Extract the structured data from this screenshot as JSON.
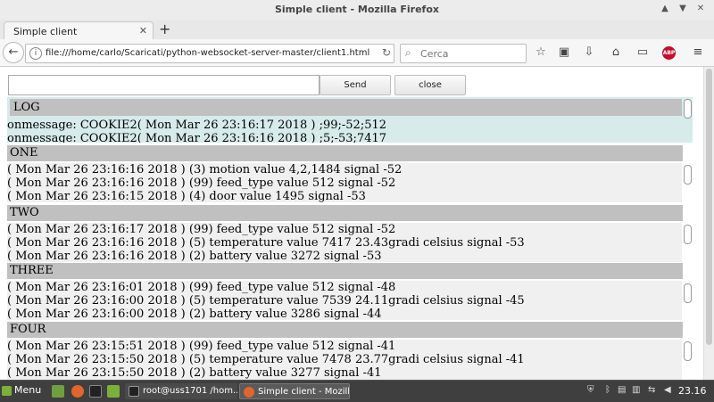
{
  "window": {
    "title": "Simple client - Mozilla Firefox"
  },
  "tab": {
    "label": "Simple client"
  },
  "nav": {
    "url": "file:///home/carlo/Scaricati/python-websocket-server-master/client1.html",
    "search_placeholder": "Cerca"
  },
  "form": {
    "send_label": "Send",
    "close_label": "close"
  },
  "log": {
    "title": "LOG",
    "lines": [
      "onmessage: COOKIE2( Mon Mar 26 23:16:17 2018 ) ;99;-52;512",
      "onmessage: COOKIE2( Mon Mar 26 23:16:16 2018 ) ;5;-53;7417"
    ]
  },
  "sections": [
    {
      "title": "ONE",
      "lines": [
        "( Mon Mar 26 23:16:16 2018 ) (3) motion value 4,2,1484 signal -52",
        "( Mon Mar 26 23:16:16 2018 ) (99) feed_type value 512 signal -52",
        "( Mon Mar 26 23:16:15 2018 ) (4) door value 1495 signal -53"
      ]
    },
    {
      "title": "TWO",
      "lines": [
        "( Mon Mar 26 23:16:17 2018 ) (99) feed_type value 512 signal -52",
        "( Mon Mar 26 23:16:16 2018 ) (5) temperature value 7417 23.43gradi celsius signal -53",
        "( Mon Mar 26 23:16:16 2018 ) (2) battery value 3272 signal -53"
      ]
    },
    {
      "title": "THREE",
      "lines": [
        "( Mon Mar 26 23:16:01 2018 ) (99) feed_type value 512 signal -48",
        "( Mon Mar 26 23:16:00 2018 ) (5) temperature value 7539 24.11gradi celsius signal -45",
        "( Mon Mar 26 23:16:00 2018 ) (2) battery value 3286 signal -44"
      ]
    },
    {
      "title": "FOUR",
      "lines": [
        "( Mon Mar 26 23:15:51 2018 ) (99) feed_type value 512 signal -41",
        "( Mon Mar 26 23:15:50 2018 ) (5) temperature value 7478 23.77gradi celsius signal -41",
        "( Mon Mar 26 23:15:50 2018 ) (2) battery value 3277 signal -41"
      ]
    }
  ],
  "taskbar": {
    "menu_label": "Menu",
    "task_terminal": "root@uss1701 /hom...",
    "task_firefox": "Simple client - Mozill...",
    "clock": "23.16"
  },
  "icons": {
    "back": "back-arrow-icon",
    "info": "info-icon",
    "reload": "reload-icon",
    "search": "search-icon",
    "bookmark": "star-icon",
    "reader": "clipboard-icon",
    "downloads": "download-icon",
    "home": "home-icon",
    "adblock": "abp-icon",
    "menu": "hamburger-menu-icon"
  },
  "colors": {
    "log_background": "#d6ebea",
    "section_background": "#f0f0f0",
    "header_background": "#c0c0c0",
    "taskbar": "#3f3f3f"
  }
}
